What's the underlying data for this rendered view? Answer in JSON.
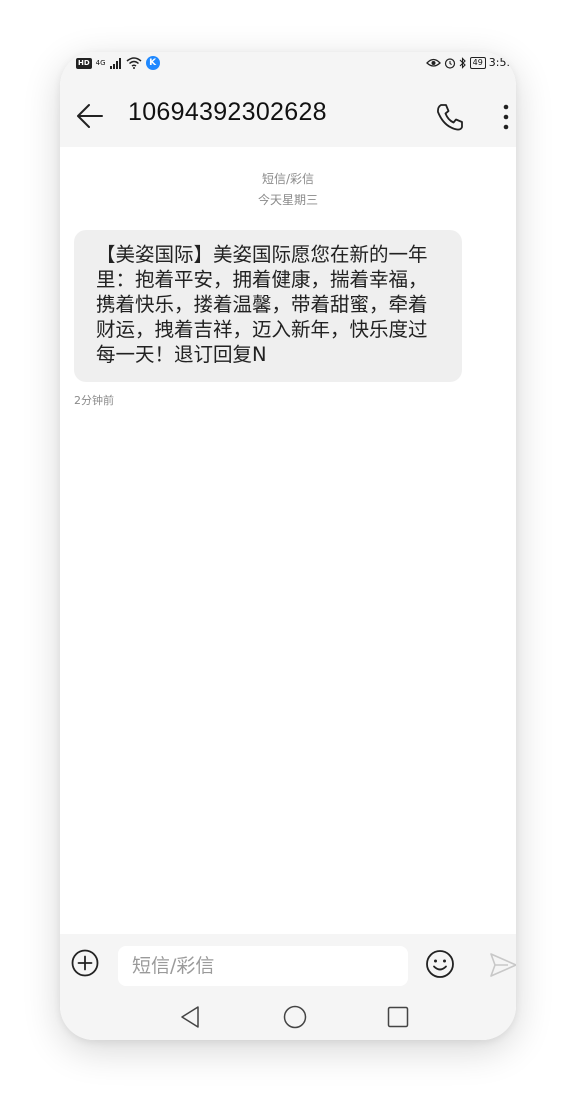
{
  "status_bar": {
    "hd": "HD",
    "network": "4G",
    "k_badge": "K",
    "battery": "49",
    "time": "3:5."
  },
  "header": {
    "back_icon": "arrow-left-icon",
    "title": "10694392302628",
    "call_icon": "phone-icon",
    "more_icon": "more-vertical-icon"
  },
  "conversation": {
    "type_label": "短信/彩信",
    "date_label": "今天星期三",
    "messages": [
      {
        "lines": [
          "【美姿国际】美姿国际愿您在新的一年",
          "里：抱着平安，拥着健康，揣着幸福，",
          "携着快乐，搂着温馨，带着甜蜜，牵着",
          "财运，拽着吉祥，迈入新年，快乐度过",
          "每一天！退订回复N"
        ],
        "time": "2分钟前"
      }
    ]
  },
  "composer": {
    "add_icon": "plus-circle-icon",
    "placeholder": "短信/彩信",
    "emoji_icon": "smiley-icon",
    "send_icon": "send-icon"
  },
  "navigation": {
    "back_icon": "triangle-back-icon",
    "home_icon": "circle-home-icon",
    "recents_icon": "square-recents-icon"
  },
  "colors": {
    "bar_background": "#f5f5f5",
    "bubble_background": "#efefef",
    "meta_text": "#8a8a8a",
    "kugou_blue": "#1e88ff"
  }
}
